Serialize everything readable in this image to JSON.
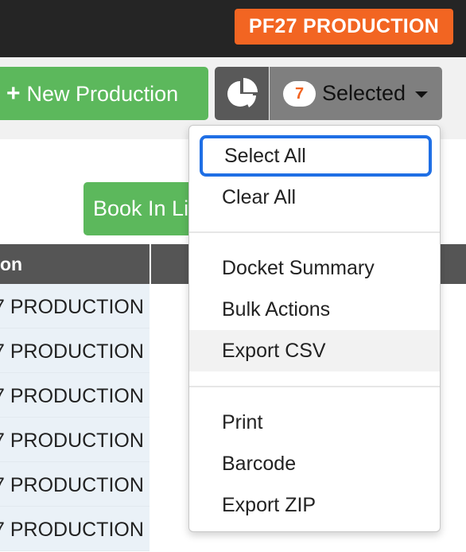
{
  "header": {
    "environment_badge": "PF27 PRODUCTION"
  },
  "toolbar": {
    "new_production_label": "New Production",
    "new_production_icon": "plus-icon",
    "chart_icon": "pie-chart-icon",
    "selected_count": "7",
    "selected_label": "Selected",
    "caret_icon": "caret-down-icon",
    "book_in_label": "Book In Li"
  },
  "table": {
    "first_column_header": "on",
    "rows": [
      "7 PRODUCTION",
      "7 PRODUCTION",
      "7 PRODUCTION",
      "7 PRODUCTION",
      "7 PRODUCTION",
      "7 PRODUCTION"
    ]
  },
  "dropdown": {
    "items": [
      {
        "label": "Select All",
        "state": "focused"
      },
      {
        "label": "Clear All"
      },
      {
        "label": "Docket Summary"
      },
      {
        "label": "Bulk Actions"
      },
      {
        "label": "Export CSV",
        "state": "hover"
      },
      {
        "label": "Print"
      },
      {
        "label": "Barcode"
      },
      {
        "label": "Export ZIP"
      }
    ]
  },
  "colors": {
    "accent_orange": "#f26522",
    "success_green": "#5cb85c",
    "focus_blue": "#1f6fe5",
    "topbar": "#252525"
  }
}
